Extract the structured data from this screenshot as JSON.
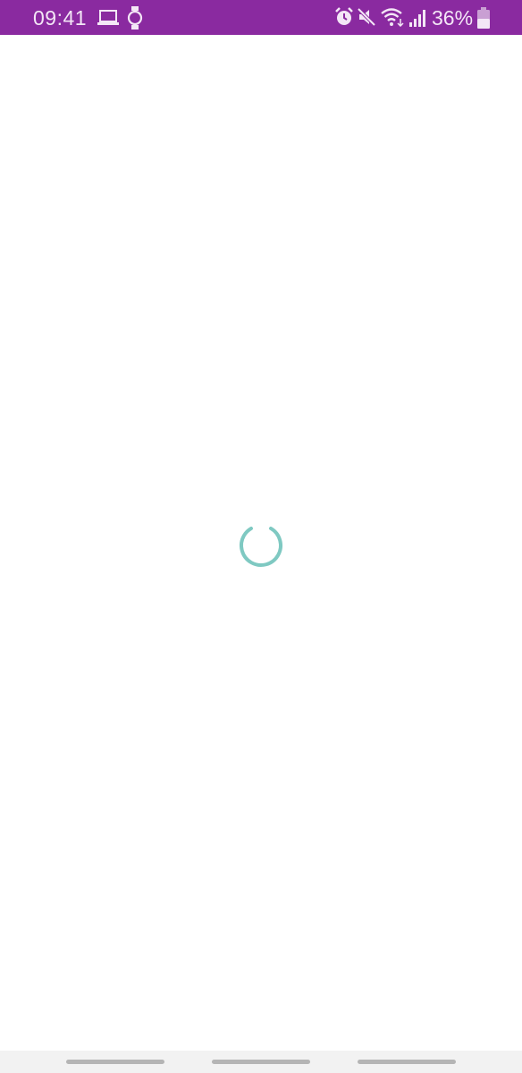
{
  "status_bar": {
    "time": "09:41",
    "battery_percent": "36%",
    "background_color": "#8a2aa0",
    "icons": [
      "laptop-icon",
      "watch-icon",
      "alarm-icon",
      "mute-icon",
      "wifi-icon",
      "signal-icon",
      "battery-icon"
    ]
  },
  "main": {
    "loading_indicator": "spinner-icon",
    "accent_color": "#7fc9c2"
  },
  "nav_bar": {
    "handles": [
      "nav-handle-left",
      "nav-handle-center",
      "nav-handle-right"
    ]
  }
}
